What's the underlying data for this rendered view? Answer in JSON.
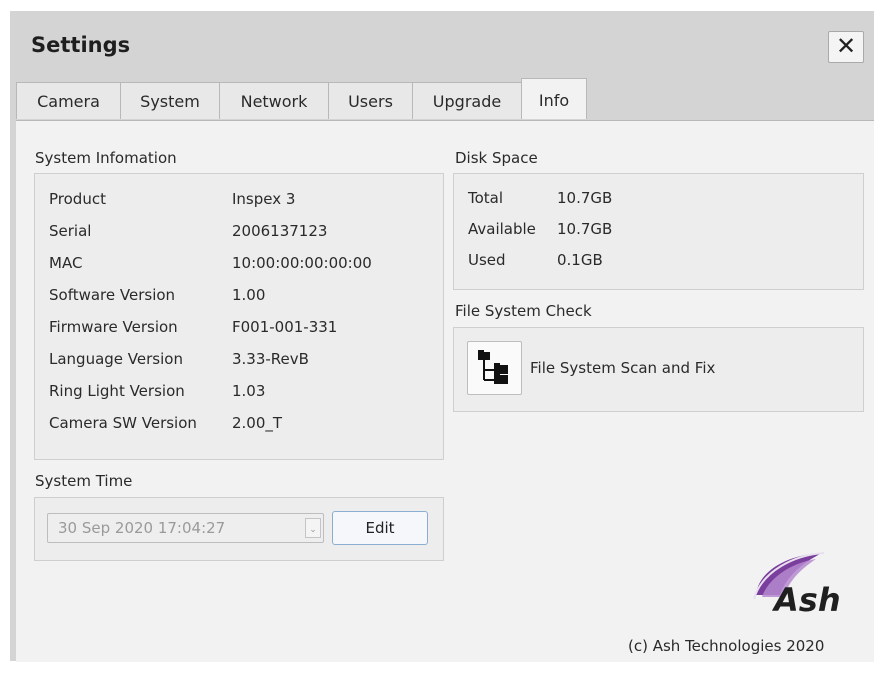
{
  "window": {
    "title": "Settings",
    "close_label": "✕"
  },
  "tabs": [
    {
      "label": "Camera"
    },
    {
      "label": "System"
    },
    {
      "label": "Network"
    },
    {
      "label": "Users"
    },
    {
      "label": "Upgrade"
    },
    {
      "label": "Info",
      "active": true
    }
  ],
  "system_info": {
    "heading": "System Infomation",
    "rows": [
      {
        "key": "Product",
        "value": "Inspex 3"
      },
      {
        "key": "Serial",
        "value": "2006137123"
      },
      {
        "key": "MAC",
        "value": "10:00:00:00:00:00"
      },
      {
        "key": "Software Version",
        "value": "1.00"
      },
      {
        "key": "Firmware Version",
        "value": "F001-001-331"
      },
      {
        "key": "Language Version",
        "value": "3.33-RevB"
      },
      {
        "key": "Ring Light Version",
        "value": "1.03"
      },
      {
        "key": "Camera SW Version",
        "value": "2.00_T"
      }
    ]
  },
  "system_time": {
    "heading": "System Time",
    "value": "30 Sep 2020 17:04:27",
    "edit_label": "Edit"
  },
  "disk_space": {
    "heading": "Disk Space",
    "rows": [
      {
        "key": "Total",
        "value": "10.7GB"
      },
      {
        "key": "Available",
        "value": "10.7GB"
      },
      {
        "key": "Used",
        "value": "0.1GB"
      }
    ]
  },
  "fs_check": {
    "heading": "File System Check",
    "button_label": "File System Scan and Fix",
    "icon": "folder-tree-icon"
  },
  "footer": {
    "logo_text": "Ash",
    "copyright": "(c)  Ash Technologies 2020"
  },
  "colors": {
    "logo_leaf": "#7a3e9c",
    "logo_text": "#1f1f1f",
    "accent_border": "#8aaed0"
  }
}
